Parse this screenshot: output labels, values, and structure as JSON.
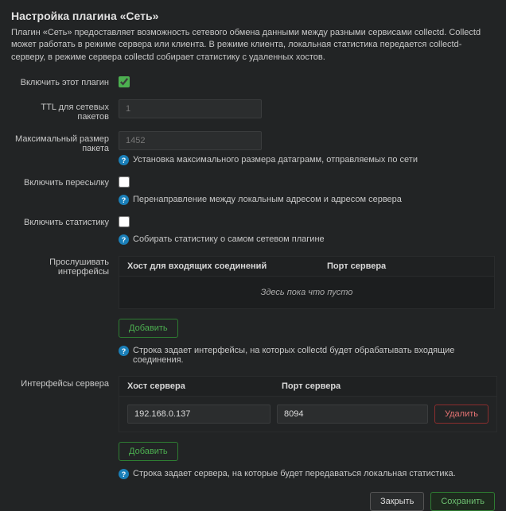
{
  "title": "Настройка плагина «Сеть»",
  "description": "Плагин «Сеть» предоставляет возможность сетевого обмена данными между разными сервисами collectd. Collectd может работать в режиме сервера или клиента. В режиме клиента, локальная статистика передается collectd-серверу, в режиме сервера collectd собирает статистику с удаленных хостов.",
  "fields": {
    "enable_label": "Включить этот плагин",
    "ttl_label": "TTL для сетевых пакетов",
    "ttl_placeholder": "1",
    "maxsize_label": "Максимальный размер пакета",
    "maxsize_placeholder": "1452",
    "maxsize_hint": "Установка максимального размера датаграмм, отправляемых по сети",
    "forward_label": "Включить пересылку",
    "forward_hint": "Перенаправление между локальным адресом и адресом сервера",
    "stats_label": "Включить статистику",
    "stats_hint": "Собирать статистику о самом сетевом плагине"
  },
  "listen": {
    "label": "Прослушивать интерфейсы",
    "col_host": "Хост для входящих соединений",
    "col_port": "Порт сервера",
    "empty": "Здесь пока что пусто",
    "add_btn": "Добавить",
    "hint": "Строка задает интерфейсы, на которых collectd будет обрабатывать входящие соединения."
  },
  "server": {
    "label": "Интерфейсы сервера",
    "col_host": "Хост сервера",
    "col_port": "Порт сервера",
    "row_host": "192.168.0.137",
    "row_port": "8094",
    "delete_btn": "Удалить",
    "add_btn": "Добавить",
    "hint": "Строка задает сервера, на которые будет передаваться локальная статистика."
  },
  "footer": {
    "close": "Закрыть",
    "save": "Сохранить"
  }
}
